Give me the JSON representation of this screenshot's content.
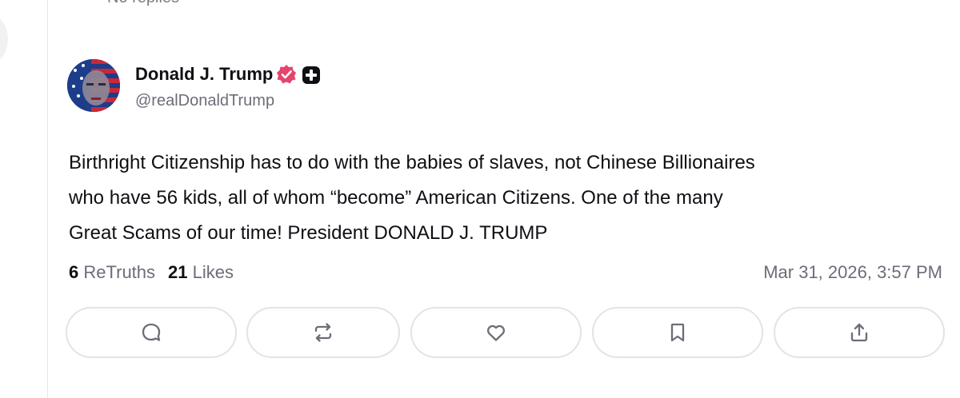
{
  "thread": {
    "previous_replies_label": "No replies"
  },
  "post": {
    "author": {
      "display_name": "Donald J. Trump",
      "handle": "@realDonaldTrump",
      "verified_badge_color": "#e5446d"
    },
    "text_lines": [
      "Birthright Citizenship has to do with the babies of slaves, not Chinese Billionaires",
      "who have 56 kids, all of whom “become” American Citizens. One of the many",
      "Great Scams of our time! President DONALD J. TRUMP"
    ],
    "stats": {
      "retruths_count": "6",
      "retruths_label": "ReTruths",
      "likes_count": "21",
      "likes_label": "Likes"
    },
    "timestamp": "Mar 31, 2026, 3:57 PM"
  },
  "actions": [
    {
      "name": "reply",
      "icon": "comment-icon"
    },
    {
      "name": "retruth",
      "icon": "repost-icon"
    },
    {
      "name": "like",
      "icon": "heart-icon"
    },
    {
      "name": "bookmark",
      "icon": "bookmark-icon"
    },
    {
      "name": "share",
      "icon": "share-icon"
    }
  ],
  "colors": {
    "icon_gray": "#6b6d78",
    "border": "#e3e3e8",
    "text": "#0f0f14"
  }
}
